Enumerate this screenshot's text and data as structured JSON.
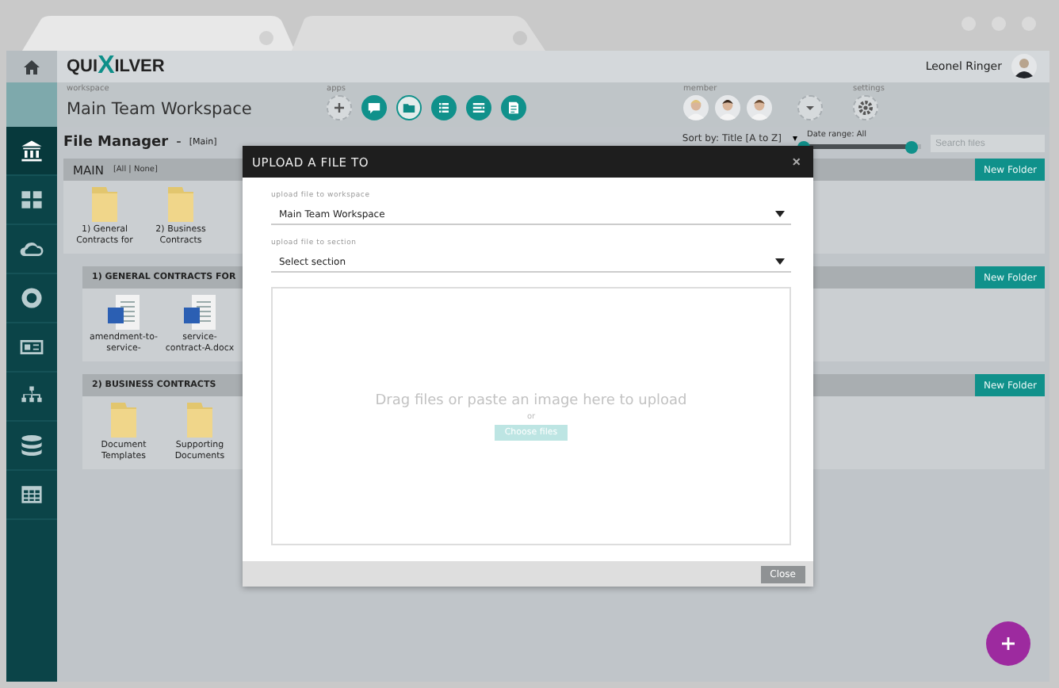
{
  "logo": {
    "left": "QUI",
    "mark": "X",
    "right": "ILVER"
  },
  "user": {
    "name": "Leonel Ringer"
  },
  "sidebar": {
    "items": [
      {
        "selected": true
      },
      {
        "selected": false
      },
      {
        "selected": false
      },
      {
        "selected": false
      },
      {
        "selected": false
      },
      {
        "selected": false
      },
      {
        "selected": false
      },
      {
        "selected": false
      }
    ]
  },
  "workspace": {
    "label": "workspace",
    "name": "Main Team Workspace"
  },
  "apps": {
    "label": "apps",
    "items": [
      {
        "kind": "add"
      },
      {
        "kind": "app"
      },
      {
        "kind": "outline"
      },
      {
        "kind": "app"
      },
      {
        "kind": "app"
      },
      {
        "kind": "app"
      }
    ]
  },
  "members": {
    "label": "member",
    "items": [
      {
        "kind": "avatar"
      },
      {
        "kind": "avatar"
      },
      {
        "kind": "avatar"
      }
    ]
  },
  "settings": {
    "label": "settings"
  },
  "file_manager": {
    "title": "File Manager",
    "separator": "-",
    "scope": "[Main]",
    "sort": "Sort by: Title [A to Z]",
    "sort_caret": "▾",
    "date_range": "Date range: All",
    "level": 0.92,
    "search_placeholder": "Search files"
  },
  "sections": [
    {
      "title": "MAIN",
      "filter": "[All | None]",
      "button": "New Folder",
      "items": [
        {
          "kind": "folder",
          "name": "1) General Contracts for"
        },
        {
          "kind": "folder",
          "name": "2) Business Contracts"
        }
      ]
    },
    {
      "title": "1) GENERAL CONTRACTS FOR",
      "button": "New Folder",
      "items": [
        {
          "kind": "doc",
          "name": "amendment-to-service-"
        },
        {
          "kind": "doc",
          "name": "service-contract-A.docx"
        }
      ]
    },
    {
      "title": "2) BUSINESS CONTRACTS",
      "button": "New Folder",
      "items": [
        {
          "kind": "folder",
          "name": "Document Templates"
        },
        {
          "kind": "folder",
          "name": "Supporting Documents"
        }
      ]
    }
  ],
  "dialog": {
    "title": "UPLOAD A FILE TO",
    "close": "×",
    "fields": [
      {
        "label": "upload file to workspace",
        "value": "Main Team Workspace"
      },
      {
        "label": "upload file to section",
        "value": "Select section"
      }
    ],
    "drop_text": "Drag files or paste an image here to upload",
    "or": "or",
    "choose": "Choose files",
    "footer_button": "Close"
  }
}
